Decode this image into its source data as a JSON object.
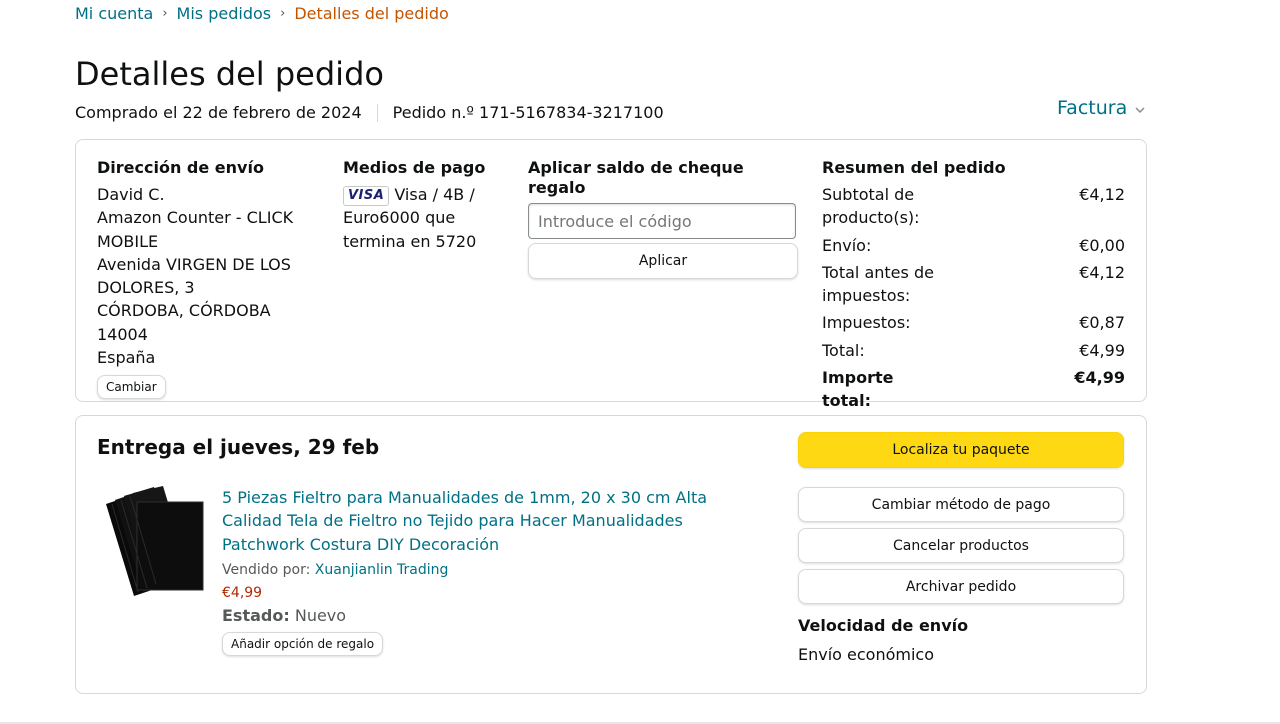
{
  "breadcrumb": {
    "items": [
      "Mi cuenta",
      "Mis pedidos"
    ],
    "current": "Detalles del pedido"
  },
  "page": {
    "title": "Detalles del pedido",
    "purchase_date": "Comprado el 22 de febrero de 2024",
    "order_number": "Pedido n.º 171-5167834-3217100",
    "invoice_label": "Factura"
  },
  "shipping": {
    "heading": "Dirección de envío",
    "lines": [
      "David C.",
      "Amazon Counter - CLICK MOBILE",
      "Avenida VIRGEN DE LOS DOLORES, 3",
      "CÓRDOBA, CÓRDOBA 14004",
      "España"
    ],
    "change_label": "Cambiar"
  },
  "payment": {
    "heading": "Medios de pago",
    "card_brand": "VISA",
    "text": "Visa / 4B / Euro6000 que termina en 5720"
  },
  "gift": {
    "heading": "Aplicar saldo de cheque regalo",
    "placeholder": "Introduce el código",
    "apply_label": "Aplicar"
  },
  "summary": {
    "heading": "Resumen del pedido",
    "rows": [
      {
        "label": "Subtotal de producto(s):",
        "value": "€4,12"
      },
      {
        "label": "Envío:",
        "value": "€0,00"
      },
      {
        "label": "Total antes de impuestos:",
        "value": "€4,12"
      },
      {
        "label": "Impuestos:",
        "value": "€0,87"
      },
      {
        "label": "Total:",
        "value": "€4,99"
      },
      {
        "label": "Importe total:",
        "value": "€4,99"
      }
    ]
  },
  "delivery": {
    "title": "Entrega el jueves, 29 feb",
    "product": {
      "title": "5 Piezas Fieltro para Manualidades de 1mm, 20 x 30 cm Alta Calidad Tela de Fieltro no Tejido para Hacer Manualidades Patchwork Costura DIY Decoración",
      "sold_by_label": "Vendido por:",
      "seller": "Xuanjianlin Trading",
      "price": "€4,99",
      "condition_label": "Estado:",
      "condition_value": "Nuevo",
      "gift_option_label": "Añadir opción de regalo"
    },
    "actions": {
      "track": "Localiza tu paquete",
      "change_payment": "Cambiar método de pago",
      "cancel": "Cancelar productos",
      "archive": "Archivar pedido"
    },
    "speed_heading": "Velocidad de envío",
    "speed_value": "Envío económico"
  },
  "colors": {
    "link": "#007185",
    "breadcrumb_current": "#c45500",
    "price": "#b12704",
    "primary_button": "#ffd814",
    "border": "#d5d9d9"
  },
  "icons": {
    "breadcrumb_separator": "chevron-right-icon",
    "invoice_dropdown": "chevron-down-icon",
    "payment_card": "visa-card-icon"
  }
}
